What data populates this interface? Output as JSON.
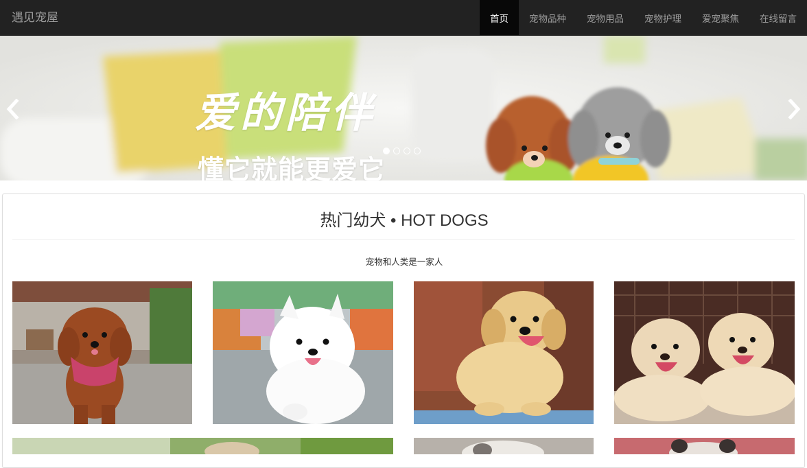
{
  "navbar": {
    "brand": "遇见宠屋",
    "items": [
      {
        "label": "首页",
        "active": true
      },
      {
        "label": "宠物品种",
        "active": false
      },
      {
        "label": "宠物用品",
        "active": false
      },
      {
        "label": "宠物护理",
        "active": false
      },
      {
        "label": "爱宠聚焦",
        "active": false
      },
      {
        "label": "在线留言",
        "active": false
      }
    ],
    "bg_color": "#222222",
    "active_bg_color": "#080808"
  },
  "carousel": {
    "caption_main": "爱的陪伴",
    "caption_sub": "懂它就能更爱它",
    "prev_icon": "chevron-left-icon",
    "next_icon": "chevron-right-icon",
    "slide_count": 4,
    "active_slide": 1
  },
  "section": {
    "title": "热门幼犬 • HOT DOGS",
    "subtitle": "宠物和人类是一家人"
  },
  "gallery": [
    {
      "name": "toy-poodle-photo"
    },
    {
      "name": "samoyed-puppy-photo"
    },
    {
      "name": "golden-retriever-puppy-photo"
    },
    {
      "name": "labrador-puppies-photo"
    },
    {
      "name": "puppy-photo-row2-1"
    },
    {
      "name": "puppy-photo-row2-2"
    },
    {
      "name": "puppy-photo-row2-3"
    }
  ]
}
